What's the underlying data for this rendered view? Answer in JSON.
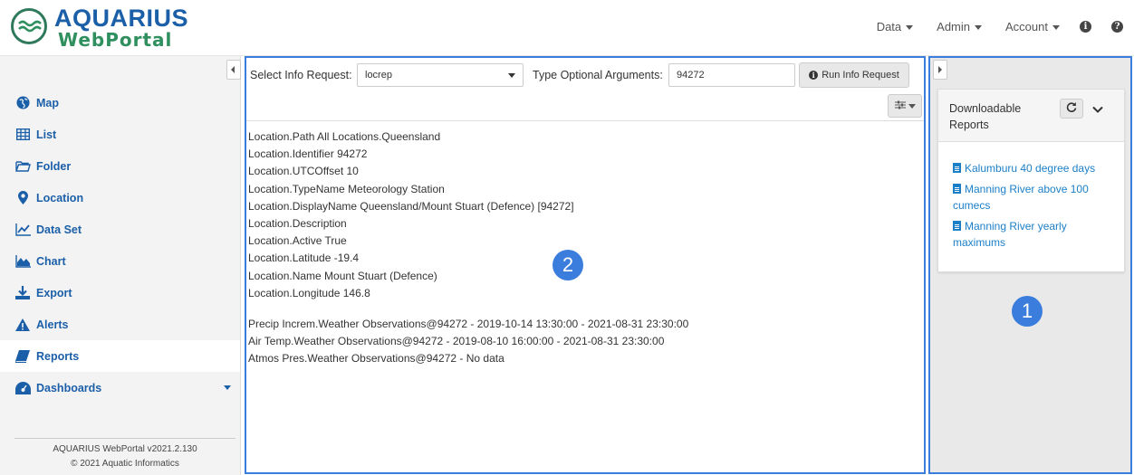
{
  "app": {
    "logo_title": "AQUARIUS",
    "logo_subtitle": "WebPortal"
  },
  "topnav": {
    "items": [
      "Data",
      "Admin",
      "Account"
    ],
    "info_icon": "info-circle-icon",
    "help_icon": "question-circle-icon"
  },
  "sidebar": {
    "items": [
      {
        "label": "Map",
        "icon": "globe-icon"
      },
      {
        "label": "List",
        "icon": "table-icon"
      },
      {
        "label": "Folder",
        "icon": "folder-icon"
      },
      {
        "label": "Location",
        "icon": "map-marker-icon"
      },
      {
        "label": "Data Set",
        "icon": "line-chart-icon"
      },
      {
        "label": "Chart",
        "icon": "area-chart-icon"
      },
      {
        "label": "Export",
        "icon": "download-icon"
      },
      {
        "label": "Alerts",
        "icon": "warning-icon"
      },
      {
        "label": "Reports",
        "icon": "book-icon"
      },
      {
        "label": "Dashboards",
        "icon": "dashboard-icon"
      }
    ],
    "active_item": "Reports",
    "footer_version": "AQUARIUS WebPortal v2021.2.130",
    "footer_copyright": "© 2021 Aquatic Informatics"
  },
  "toolbar": {
    "select_label": "Select Info Request:",
    "select_value": "locrep",
    "args_label": "Type Optional Arguments:",
    "args_value": "94272",
    "run_button": "Run Info Request"
  },
  "results": {
    "lines": [
      "Location.Path All Locations.Queensland",
      "Location.Identifier 94272",
      "Location.UTCOffset 10",
      "Location.TypeName Meteorology Station",
      "Location.DisplayName Queensland/Mount Stuart (Defence) [94272]",
      "Location.Description",
      "Location.Active True",
      "Location.Latitude -19.4",
      "Location.Name Mount Stuart (Defence)",
      "Location.Longitude 146.8"
    ],
    "datasets": [
      "Precip Increm.Weather Observations@94272 - 2019-10-14 13:30:00 - 2021-08-31 23:30:00",
      "Air Temp.Weather Observations@94272 - 2019-08-10 16:00:00 - 2021-08-31 23:30:00",
      "Atmos Pres.Weather Observations@94272 - No data"
    ]
  },
  "reports_panel": {
    "title": "Downloadable Reports",
    "reports": [
      "Kalumburu 40 degree days",
      "Manning River above 100 cumecs",
      "Manning River yearly maximums"
    ]
  },
  "badges": {
    "main": "2",
    "right": "1"
  },
  "colors": {
    "accent": "#1b5fa8",
    "highlight_border": "#3b7ddd",
    "link": "#1b7fc8",
    "logo_green": "#2f8f5e"
  }
}
